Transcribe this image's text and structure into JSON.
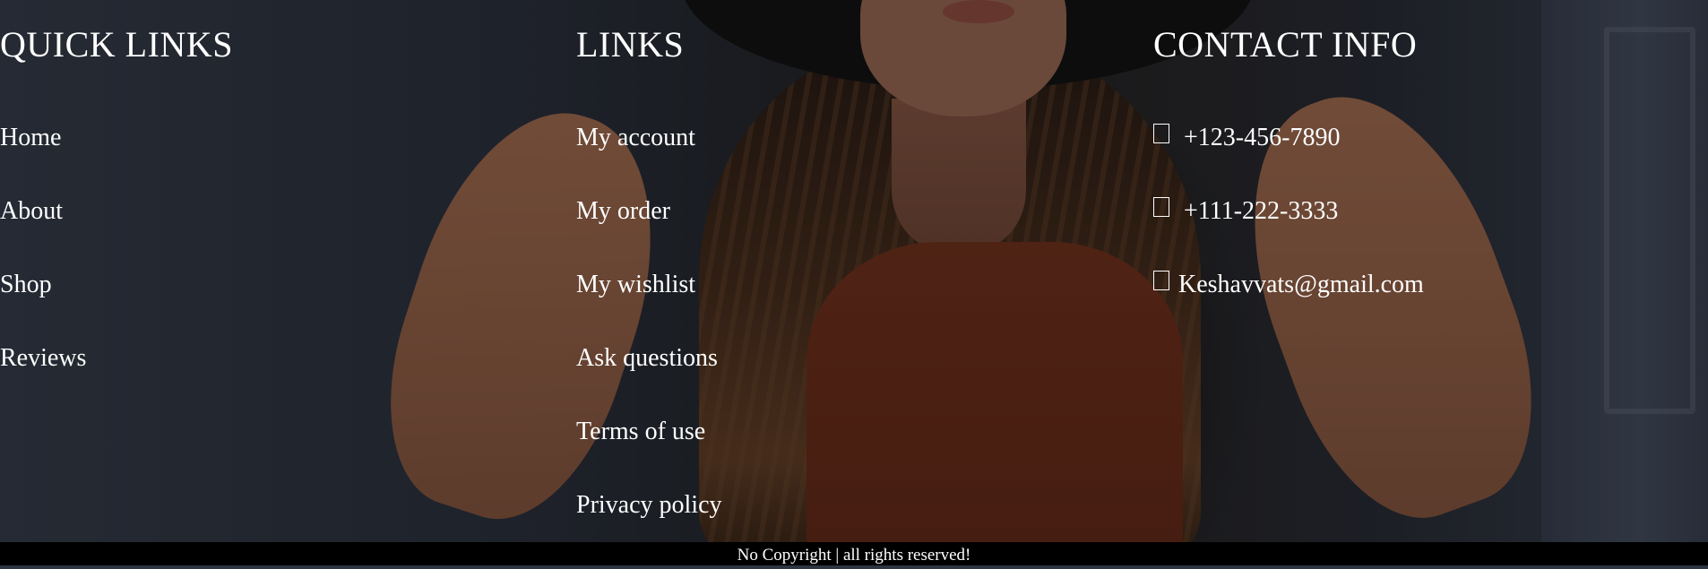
{
  "quick_links": {
    "heading": "QUICK LINKS",
    "items": [
      "Home",
      "About",
      "Shop",
      "Reviews"
    ]
  },
  "links": {
    "heading": "LINKS",
    "items": [
      "My account",
      "My order",
      "My wishlist",
      "Ask questions",
      "Terms of use",
      "Privacy policy"
    ]
  },
  "contact": {
    "heading": "CONTACT INFO",
    "items": [
      {
        "icon": "phone-icon",
        "text": "+123-456-7890"
      },
      {
        "icon": "phone-icon",
        "text": "+111-222-3333"
      },
      {
        "icon": "envelope-icon",
        "text": "Keshavvats@gmail.com"
      }
    ]
  },
  "footer": {
    "copyright": "No Copyright | all rights reserved!"
  }
}
